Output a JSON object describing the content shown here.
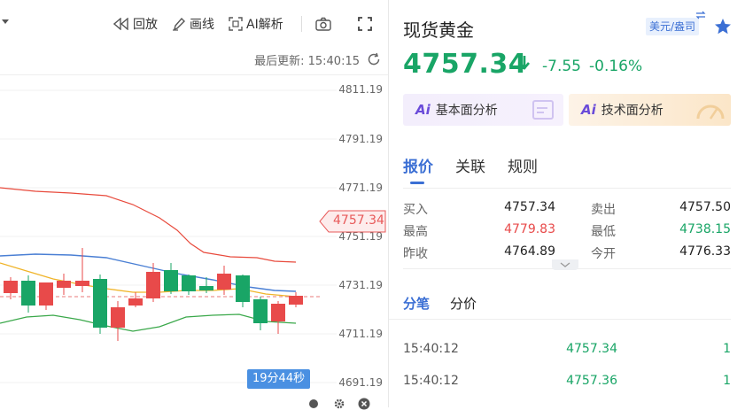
{
  "toolbar": {
    "replay_label": "回放",
    "draw_label": "画线",
    "ai_label": "AI解析"
  },
  "chart": {
    "last_update": "最后更新: 15:40:15",
    "price_ticks": [
      "4811.19",
      "4791.19",
      "4771.19",
      "4751.19",
      "4731.19",
      "4711.19",
      "4691.19"
    ],
    "current_price_tag": "4757.34",
    "countdown": "19分44秒"
  },
  "quote": {
    "title": "现货黄金",
    "unit": "美元/盎司",
    "price": "4757.34",
    "change": "-7.55",
    "change_pct": "-0.16%",
    "fundamental_btn": "基本面分析",
    "technical_btn": "技术面分析",
    "ai_badge": "Ai",
    "tabs": [
      "报价",
      "关联",
      "规则"
    ],
    "rows": [
      {
        "l1": "买入",
        "v1": "4757.34",
        "l2": "卖出",
        "v2": "4757.50"
      },
      {
        "l1": "最高",
        "v1": "4779.83",
        "l2": "最低",
        "v2": "4738.15"
      },
      {
        "l1": "昨收",
        "v1": "4764.89",
        "l2": "今开",
        "v2": "4776.33"
      }
    ],
    "ticks_tabs": [
      "分笔",
      "分价"
    ],
    "ticks": [
      {
        "time": "15:40:12",
        "price": "4757.34",
        "vol": "1"
      },
      {
        "time": "15:40:12",
        "price": "4757.36",
        "vol": "1"
      }
    ]
  },
  "colors": {
    "up": "#e84a4a",
    "down": "#19a566",
    "accent": "#3b6fd4",
    "ma_blue": "#4a7fd4",
    "ma_yellow": "#f0b429",
    "band_red": "#e84a3c",
    "band_green": "#3aa84a"
  }
}
